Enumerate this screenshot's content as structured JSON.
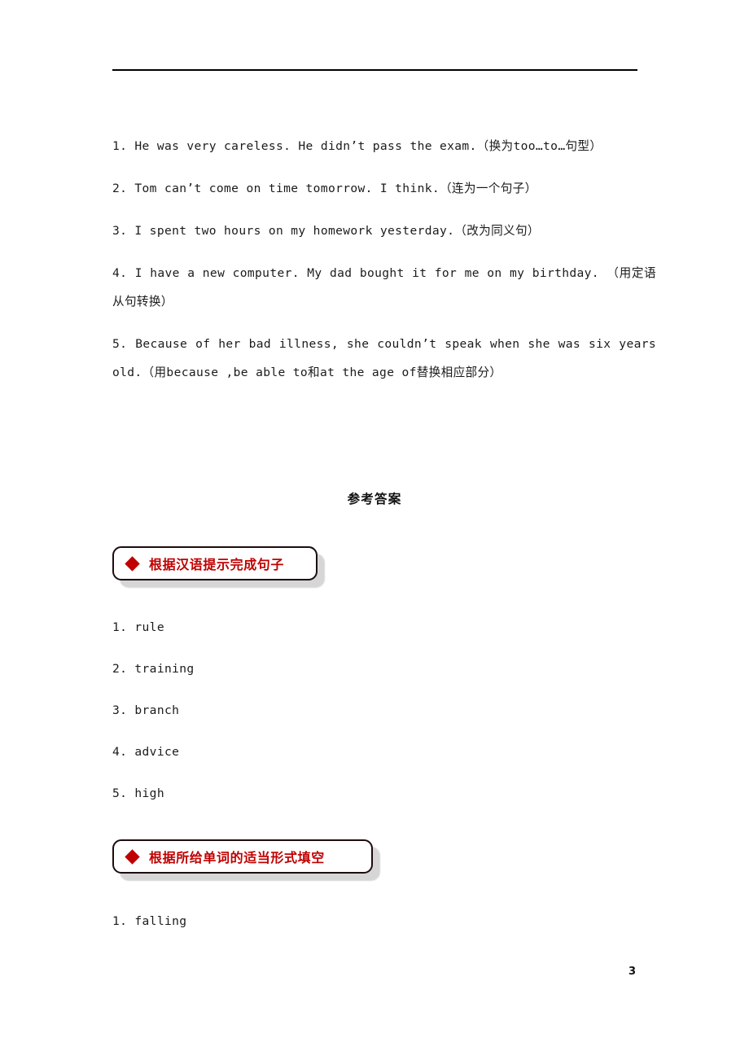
{
  "page": {
    "page_number": "3",
    "header_rule": "horizontal-rule"
  },
  "exercise_section": {
    "items": [
      "1. He was very careless. He didn’t pass the exam.（换为too…to…句型）",
      "2. Tom can’t come on time tomorrow. I think.（连为一个句子）",
      "3. I spent two hours on my homework yesterday.（改为同义句）",
      "4. I have a new computer. My dad bought it for me on my birthday. （用定语从句转换）",
      "5. Because of her bad illness, she couldn’t speak when she was six years old.（用because ,be able to和at the age of替换相应部分）"
    ]
  },
  "answers_section": {
    "title": "参考答案",
    "banners": [
      {
        "bullet": "diamond-icon",
        "label": "根据汉语提示完成句子",
        "color": "#C00000",
        "border_color": "#1D0D0D"
      },
      {
        "bullet": "diamond-icon",
        "label": "根据所给单词的适当形式填空",
        "color": "#C00000",
        "border_color": "#1D0D0D"
      }
    ],
    "answer_groups": [
      {
        "items": [
          "1. rule",
          "2. training",
          "3. branch",
          "4. advice",
          "5. high"
        ]
      },
      {
        "items": [
          "1. falling"
        ]
      }
    ]
  }
}
